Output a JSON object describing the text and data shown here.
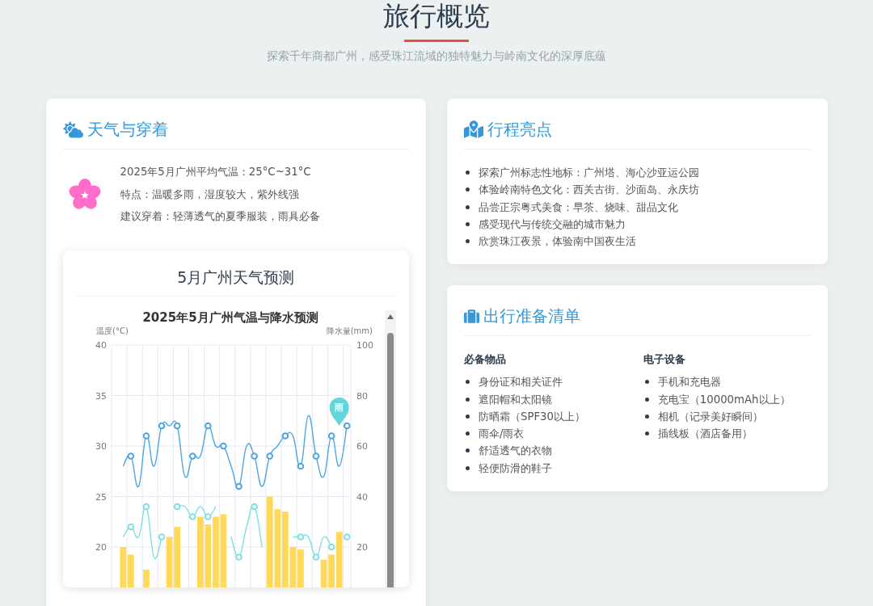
{
  "header": {
    "title": "旅行概览",
    "subtitle": "探索千年商都广州，感受珠江流域的独特魅力与岭南文化的深厚底蕴"
  },
  "weather": {
    "title": "天气与穿着",
    "details": [
      "2025年5月广州平均气温：25°C~31°C",
      "特点：温暖多雨，湿度较大，紫外线强",
      "建议穿着：轻薄透气的夏季服装，雨具必备"
    ],
    "forecast": {
      "title": "5月广州天气预测",
      "chart_data": {
        "type": "line",
        "title": "2025年5月广州气温与降水预测",
        "ylabel": "温度(°C)",
        "y2label": "降水量(mm)",
        "ylim": [
          16,
          40
        ],
        "yticks": [
          20,
          25,
          30,
          35,
          40
        ],
        "y2lim": [
          4,
          100
        ],
        "y2ticks": [
          20,
          40,
          60,
          80,
          100
        ],
        "grid": true,
        "series": [
          {
            "color": "#4ea5e0",
            "values": [
              null,
              28,
              29,
              26,
              31,
              28,
              32,
              32,
              32,
              27,
              29,
              29,
              32,
              30,
              30,
              28,
              26,
              30,
              29,
              26,
              29,
              30,
              31,
              31,
              28,
              33,
              29,
              27,
              31,
              28,
              32
            ]
          },
          {
            "color": "#7fdfe3",
            "values": [
              null,
              21,
              22,
              21,
              24,
              19,
              21,
              null,
              24,
              24,
              23,
              24,
              23,
              24,
              null,
              21,
              19,
              22,
              24,
              20,
              null,
              null,
              null,
              21,
              21,
              21,
              19,
              21,
              20,
              null,
              21
            ]
          },
          {
            "type": "bar",
            "axis": "y2",
            "color": "#ffd95a",
            "values": [
              null,
              20,
              17,
              null,
              11,
              null,
              null,
              24,
              28,
              null,
              null,
              32,
              29,
              32,
              33,
              null,
              null,
              null,
              null,
              null,
              40,
              35,
              34,
              20,
              19,
              null,
              null,
              15,
              17,
              26,
              null
            ]
          }
        ],
        "annotations": [
          "雨"
        ]
      }
    }
  },
  "highlights": {
    "title": "行程亮点",
    "items": [
      "探索广州标志性地标：广州塔、海心沙亚运公园",
      "体验岭南特色文化：西关古街、沙面岛、永庆坊",
      "品尝正宗粤式美食：早茶、烧味、甜品文化",
      "感受现代与传统交融的城市魅力",
      "欣赏珠江夜景，体验南中国夜生活"
    ]
  },
  "checklist": {
    "title": "出行准备清单",
    "groups": [
      {
        "heading": "必备物品",
        "items": [
          "身份证和相关证件",
          "遮阳帽和太阳镜",
          "防晒霜（SPF30以上）",
          "雨伞/雨衣",
          "舒适透气的衣物",
          "轻便防滑的鞋子"
        ]
      },
      {
        "heading": "电子设备",
        "items": [
          "手机和充电器",
          "充电宝（10000mAh以上）",
          "相机（记录美好瞬间）",
          "插线板（酒店备用）"
        ]
      }
    ]
  }
}
